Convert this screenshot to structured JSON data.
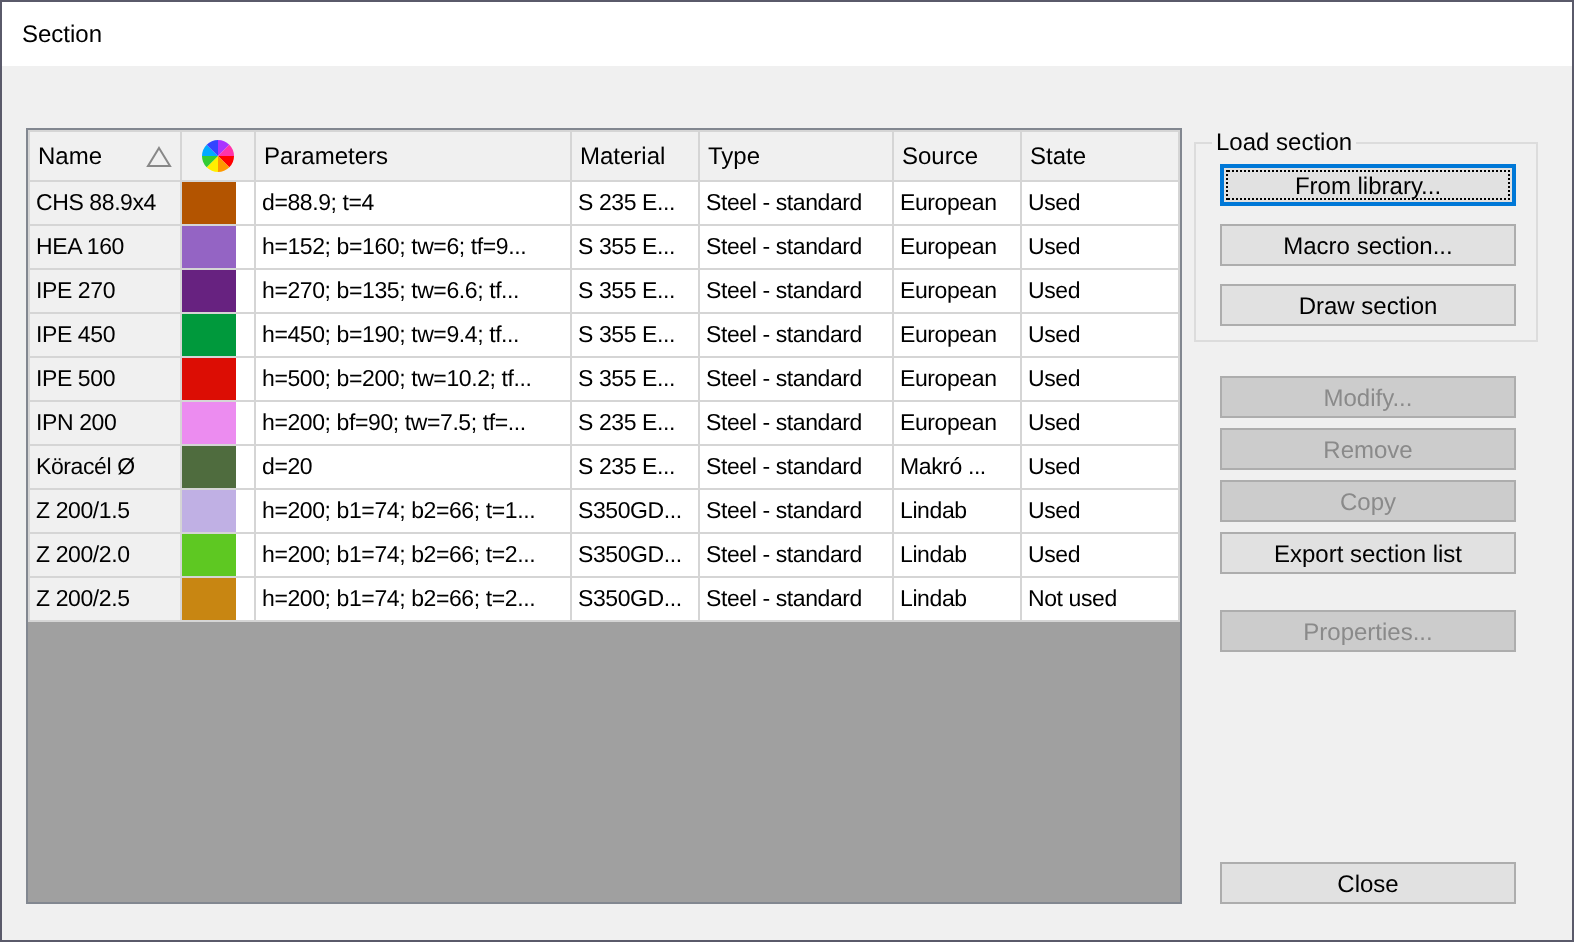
{
  "window": {
    "title": "Section"
  },
  "table": {
    "columns": [
      {
        "label": "Name",
        "sorted": true
      },
      {
        "kind": "color"
      },
      {
        "label": "Parameters"
      },
      {
        "label": "Material"
      },
      {
        "label": "Type"
      },
      {
        "label": "Source"
      },
      {
        "label": "State"
      }
    ],
    "rows": [
      {
        "name": "CHS 88.9x4",
        "color": "#b35400",
        "parameters": "d=88.9; t=4",
        "material": "S 235 E...",
        "type": "Steel - standard",
        "source": "European",
        "state": "Used"
      },
      {
        "name": "HEA 160",
        "color": "#9464c4",
        "parameters": "h=152; b=160; tw=6; tf=9...",
        "material": "S 355 E...",
        "type": "Steel - standard",
        "source": "European",
        "state": "Used"
      },
      {
        "name": "IPE 270",
        "color": "#672280",
        "parameters": "h=270; b=135; tw=6.6; tf...",
        "material": "S 355 E...",
        "type": "Steel - standard",
        "source": "European",
        "state": "Used"
      },
      {
        "name": "IPE 450",
        "color": "#00993c",
        "parameters": "h=450; b=190; tw=9.4; tf...",
        "material": "S 355 E...",
        "type": "Steel - standard",
        "source": "European",
        "state": "Used"
      },
      {
        "name": "IPE 500",
        "color": "#dc0d04",
        "parameters": "h=500; b=200; tw=10.2; tf...",
        "material": "S 355 E...",
        "type": "Steel - standard",
        "source": "European",
        "state": "Used"
      },
      {
        "name": "IPN 200",
        "color": "#ec8cf0",
        "parameters": "h=200; bf=90; tw=7.5; tf=...",
        "material": "S 235 E...",
        "type": "Steel - standard",
        "source": "European",
        "state": "Used"
      },
      {
        "name": "Köracél Ø",
        "color": "#4f6c3e",
        "parameters": "d=20",
        "material": "S 235 E...",
        "type": "Steel - standard",
        "source": "Makró ...",
        "state": "Used"
      },
      {
        "name": "Z 200/1.5",
        "color": "#c0b0e4",
        "parameters": "h=200; b1=74; b2=66; t=1...",
        "material": "S350GD...",
        "type": "Steel - standard",
        "source": "Lindab",
        "state": "Used"
      },
      {
        "name": "Z 200/2.0",
        "color": "#5ec822",
        "parameters": "h=200; b1=74; b2=66; t=2...",
        "material": "S350GD...",
        "type": "Steel - standard",
        "source": "Lindab",
        "state": "Used"
      },
      {
        "name": "Z 200/2.5",
        "color": "#c88612",
        "parameters": "h=200; b1=74; b2=66; t=2...",
        "material": "S350GD...",
        "type": "Steel - standard",
        "source": "Lindab",
        "state": "Not used"
      }
    ]
  },
  "load_section": {
    "title": "Load section",
    "buttons": [
      {
        "label": "From library...",
        "focused": true,
        "disabled": false
      },
      {
        "label": "Macro section...",
        "focused": false,
        "disabled": false
      },
      {
        "label": "Draw section",
        "focused": false,
        "disabled": false
      }
    ]
  },
  "actions": [
    {
      "label": "Modify...",
      "disabled": true
    },
    {
      "label": "Remove",
      "disabled": true
    },
    {
      "label": "Copy",
      "disabled": true
    },
    {
      "label": "Export section list",
      "disabled": false
    }
  ],
  "properties_button": {
    "label": "Properties...",
    "disabled": true
  },
  "close_button": {
    "label": "Close"
  }
}
